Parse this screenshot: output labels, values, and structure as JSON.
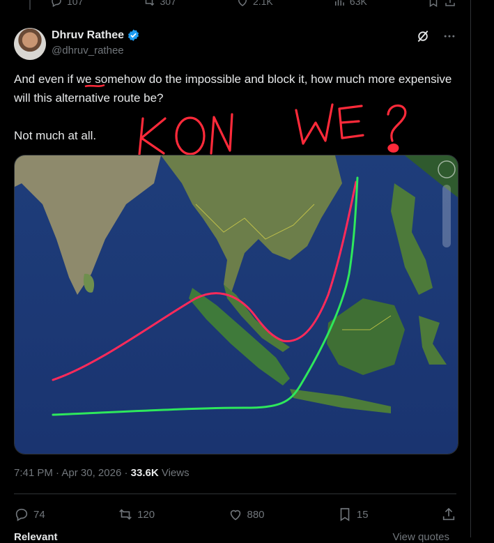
{
  "prev_tweet": {
    "replies": "107",
    "reposts": "307",
    "likes": "2.1K",
    "views": "63K"
  },
  "author": {
    "name": "Dhruv Rathee",
    "handle": "@dhruv_rathee"
  },
  "tweet": {
    "line1": "And even if we somehow do the impossible and block it, how much more expensive will this alternative route be?",
    "line2": "Not much at all.",
    "underlined_word": "we"
  },
  "annotation": {
    "handwritten": "KON WE?"
  },
  "meta": {
    "time": "7:41 PM",
    "sep": " · ",
    "date": "Apr 30, 2026",
    "views_count": "33.6K",
    "views_label": "Views"
  },
  "actions": {
    "replies": "74",
    "reposts": "120",
    "likes": "880",
    "bookmarks": "15"
  },
  "footer": {
    "left": "Relevant",
    "right": "View quotes"
  },
  "colors": {
    "accent": "#1d9bf0",
    "red_route": "#ff2a5a",
    "green_route": "#2ee85c",
    "scribble": "#ff2a3a"
  }
}
